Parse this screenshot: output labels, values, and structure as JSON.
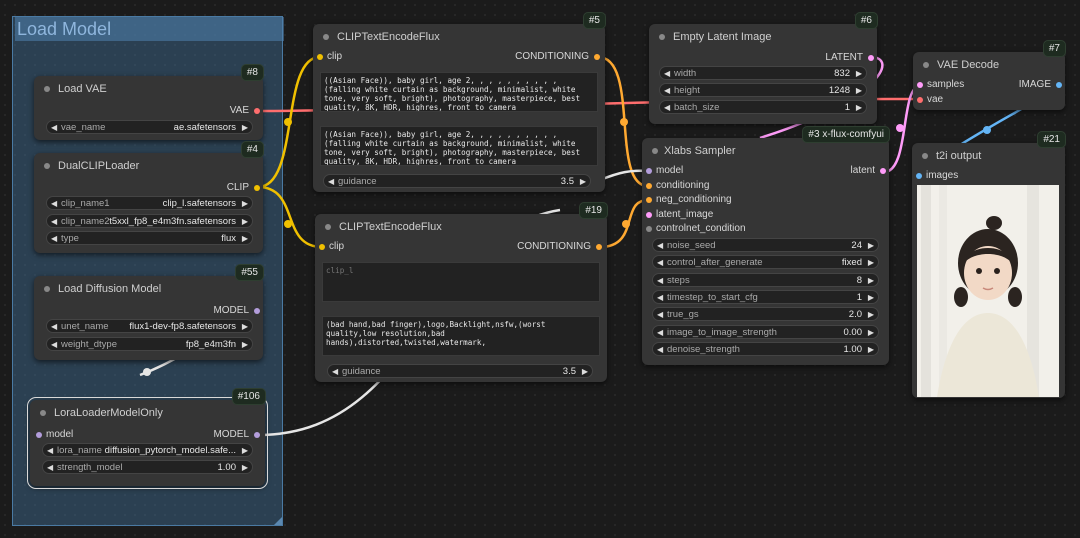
{
  "group": {
    "title": "Load Model"
  },
  "nodes": {
    "vae": {
      "title": "Load VAE",
      "badge": "#8",
      "output": "VAE",
      "widgets": [
        {
          "name": "vae_name",
          "value": "ae.safetensors"
        }
      ]
    },
    "dualclip": {
      "title": "DualCLIPLoader",
      "badge": "#4",
      "output": "CLIP",
      "widgets": [
        {
          "name": "clip_name1",
          "value": "clip_l.safetensors"
        },
        {
          "name": "clip_name2",
          "value": "t5xxl_fp8_e4m3fn.safetensors"
        },
        {
          "name": "type",
          "value": "flux"
        }
      ]
    },
    "diffusion": {
      "title": "Load Diffusion Model",
      "badge": "#55",
      "output": "MODEL",
      "widgets": [
        {
          "name": "unet_name",
          "value": "flux1-dev-fp8.safetensors"
        },
        {
          "name": "weight_dtype",
          "value": "fp8_e4m3fn"
        }
      ]
    },
    "lora": {
      "title": "LoraLoaderModelOnly",
      "badge": "#106",
      "input": "model",
      "output": "MODEL",
      "widgets": [
        {
          "name": "lora_name",
          "value": "diffusion_pytorch_model.safe..."
        },
        {
          "name": "strength_model",
          "value": "1.00"
        }
      ]
    },
    "clip1": {
      "title": "CLIPTextEncodeFlux",
      "badge": "#5",
      "input": "clip",
      "output": "CONDITIONING",
      "text1": "((Asian Face)), baby girl, age 2, , , , , , , , , , (falling white curtain as background, minimalist, white tone, very soft, bright), photography, masterpiece, best quality, 8K, HDR, highres, front to camera",
      "text2": "((Asian Face)), baby girl, age 2, , , , , , , , , , (falling white curtain as background, minimalist, white tone, very soft, bright), photography, masterpiece, best quality, 8K, HDR, highres, front to camera",
      "widgets": [
        {
          "name": "guidance",
          "value": "3.5"
        }
      ]
    },
    "clip2": {
      "title": "CLIPTextEncodeFlux",
      "badge": "#19",
      "input": "clip",
      "output": "CONDITIONING",
      "placeholder1": "clip_l",
      "text2": "(bad hand,bad finger),logo,Backlight,nsfw,(worst quality,low resolution,bad hands),distorted,twisted,watermark,",
      "widgets": [
        {
          "name": "guidance",
          "value": "3.5"
        }
      ]
    },
    "latent": {
      "title": "Empty Latent Image",
      "badge": "#6",
      "output": "LATENT",
      "widgets": [
        {
          "name": "width",
          "value": "832"
        },
        {
          "name": "height",
          "value": "1248"
        },
        {
          "name": "batch_size",
          "value": "1"
        }
      ]
    },
    "sampler": {
      "title": "Xlabs Sampler",
      "badge": "#3 x-flux-comfyui",
      "output": "latent",
      "inputs": [
        "model",
        "conditioning",
        "neg_conditioning",
        "latent_image",
        "controlnet_condition"
      ],
      "widgets": [
        {
          "name": "noise_seed",
          "value": "24"
        },
        {
          "name": "control_after_generate",
          "value": "fixed"
        },
        {
          "name": "steps",
          "value": "8"
        },
        {
          "name": "timestep_to_start_cfg",
          "value": "1"
        },
        {
          "name": "true_gs",
          "value": "2.0"
        },
        {
          "name": "image_to_image_strength",
          "value": "0.00"
        },
        {
          "name": "denoise_strength",
          "value": "1.00"
        }
      ]
    },
    "vaedecode": {
      "title": "VAE Decode",
      "badge": "#7",
      "inputs": [
        "samples",
        "vae"
      ],
      "output": "IMAGE"
    },
    "output": {
      "title": "t2i output",
      "badge": "#21",
      "input": "images"
    }
  },
  "colors": {
    "clip": "#f0c000",
    "conditioning": "#ffa931",
    "vae": "#ff6e6e",
    "model": "#b39ddb",
    "latent": "#ff9cf9",
    "image": "#64b5f6"
  },
  "icons": {
    "arrow_left": "◀",
    "arrow_right": "▶"
  }
}
